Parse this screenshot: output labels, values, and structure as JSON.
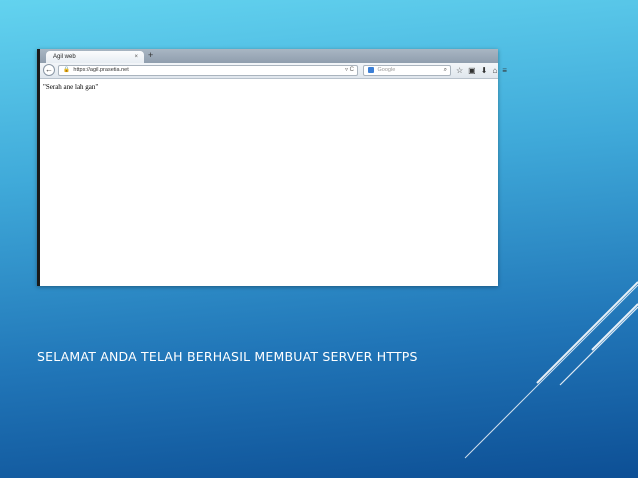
{
  "browser": {
    "tab_title": "Agil web",
    "tab_close": "×",
    "new_tab": "+",
    "back": "←",
    "url": "https://agil.prasetia.net",
    "url_controls": "▿ C",
    "search_placeholder": "Google",
    "toolbar_icons": [
      "star-icon",
      "clipboard-icon",
      "download-icon",
      "home-icon",
      "menu-icon"
    ],
    "page_text": "\"Serah ane lah gan\""
  },
  "slide": {
    "caption": "SELAMAT ANDA TELAH BERHASIL MEMBUAT SERVER HTTPS"
  },
  "colors": {
    "background_top": "#63d3ef",
    "background_bottom": "#0d4f95",
    "caption": "#ffffff"
  }
}
